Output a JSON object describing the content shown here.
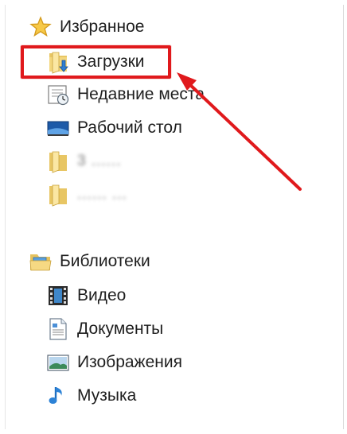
{
  "favorites": {
    "header": "Избранное",
    "items": [
      {
        "label": "Загрузки",
        "icon": "downloads-folder-icon"
      },
      {
        "label": "Недавние места",
        "icon": "recent-places-icon"
      },
      {
        "label": "Рабочий стол",
        "icon": "desktop-icon"
      },
      {
        "label": "3 ......",
        "icon": "folder-icon"
      },
      {
        "label": "...... ...",
        "icon": "folder-icon"
      }
    ]
  },
  "libraries": {
    "header": "Библиотеки",
    "items": [
      {
        "label": "Видео",
        "icon": "video-library-icon"
      },
      {
        "label": "Документы",
        "icon": "documents-library-icon"
      },
      {
        "label": "Изображения",
        "icon": "pictures-library-icon"
      },
      {
        "label": "Музыка",
        "icon": "music-library-icon"
      }
    ]
  },
  "annotation": {
    "color": "#e0191c"
  }
}
